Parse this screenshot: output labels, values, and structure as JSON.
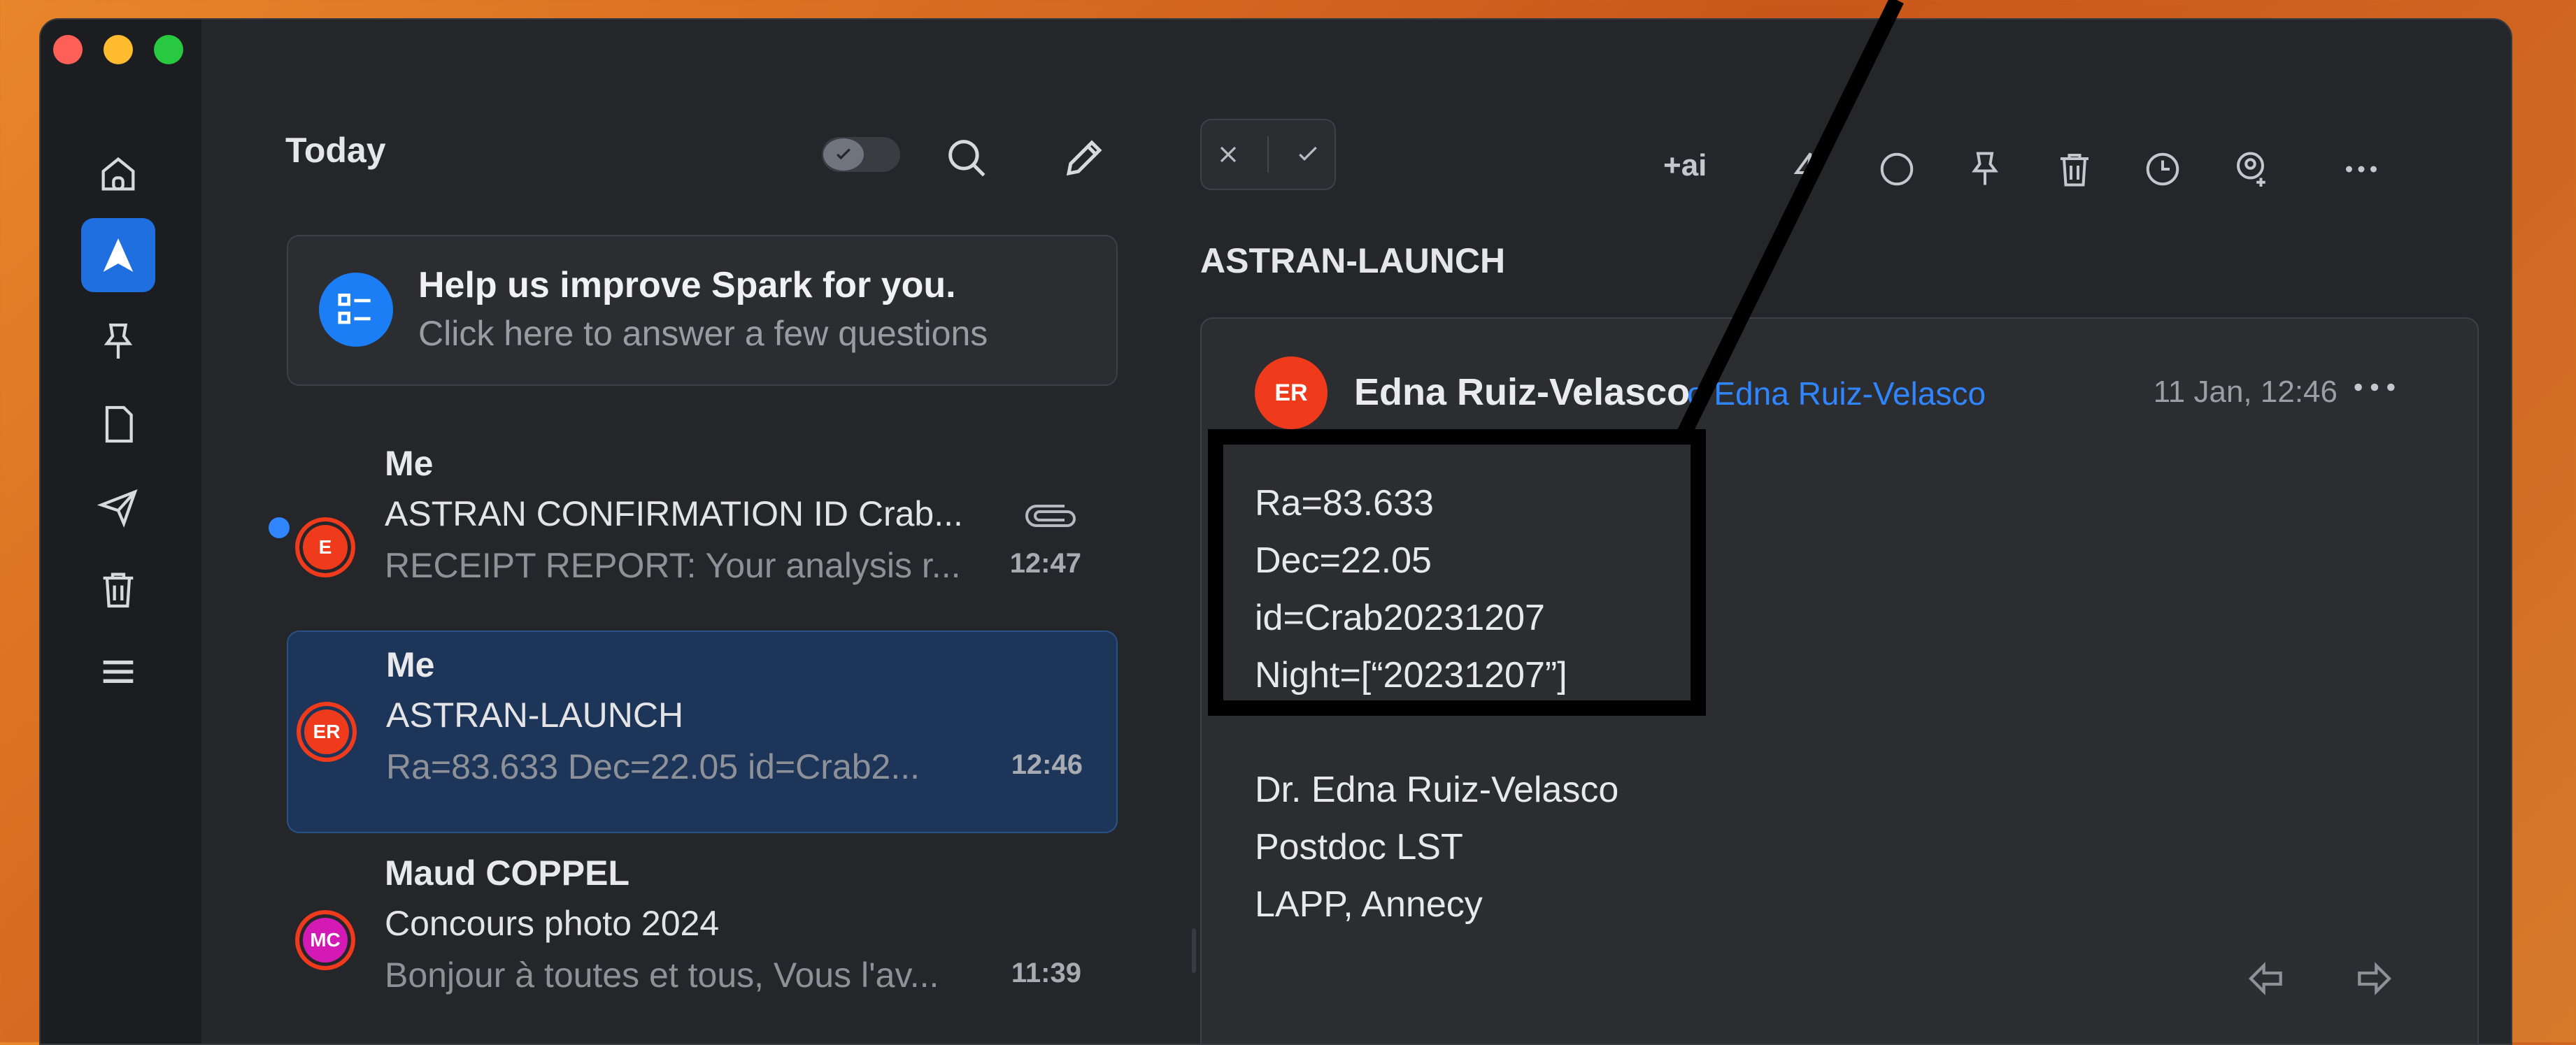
{
  "window": {
    "traffic_lights": [
      "close",
      "minimize",
      "zoom"
    ]
  },
  "sidebar": {
    "items": [
      {
        "name": "home",
        "icon": "home-icon"
      },
      {
        "name": "smart-inbox",
        "icon": "paper-plane-icon",
        "active": true
      },
      {
        "name": "pinned",
        "icon": "pin-icon"
      },
      {
        "name": "drafts",
        "icon": "document-icon"
      },
      {
        "name": "sent",
        "icon": "send-icon"
      },
      {
        "name": "trash",
        "icon": "trash-icon"
      },
      {
        "name": "menu",
        "icon": "hamburger-icon"
      }
    ]
  },
  "list": {
    "header": "Today",
    "promo": {
      "title": "Help us improve Spark for you.",
      "subtitle": "Click here to answer a few questions"
    },
    "emails": [
      {
        "from": "Me",
        "subject": "ASTRAN CONFIRMATION ID Crab...",
        "preview": "RECEIPT REPORT: Your analysis r...",
        "time": "12:47",
        "avatar": "E",
        "unread": true,
        "attachment": true
      },
      {
        "from": "Me",
        "subject": "ASTRAN-LAUNCH",
        "preview": "Ra=83.633 Dec=22.05 id=Crab2...",
        "time": "12:46",
        "avatar": "ER",
        "selected": true
      },
      {
        "from": "Maud COPPEL",
        "subject": "Concours photo 2024",
        "preview": "Bonjour à toutes et tous, Vous l'av...",
        "time": "11:39",
        "avatar": "MC"
      }
    ]
  },
  "toolbar": {
    "ai_label": "+ai"
  },
  "detail": {
    "title": "ASTRAN-LAUNCH",
    "sender": "Edna Ruiz-Velasco",
    "avatar": "ER",
    "to": "o Edna Ruiz-Velasco",
    "date": "11 Jan, 12:46",
    "body": [
      "Ra=83.633",
      "Dec=22.05",
      "id=Crab20231207",
      "Night=[“20231207”]"
    ],
    "signature": [
      "Dr. Edna Ruiz-Velasco",
      "Postdoc LST",
      "LAPP, Annecy"
    ]
  },
  "colors": {
    "accent": "#1f6fe0",
    "selected_row": "#1c3558",
    "link": "#2f86ff",
    "avatar_red": "#ef3a1c",
    "avatar_magenta": "#d41ab5",
    "annotation": "#000000"
  }
}
